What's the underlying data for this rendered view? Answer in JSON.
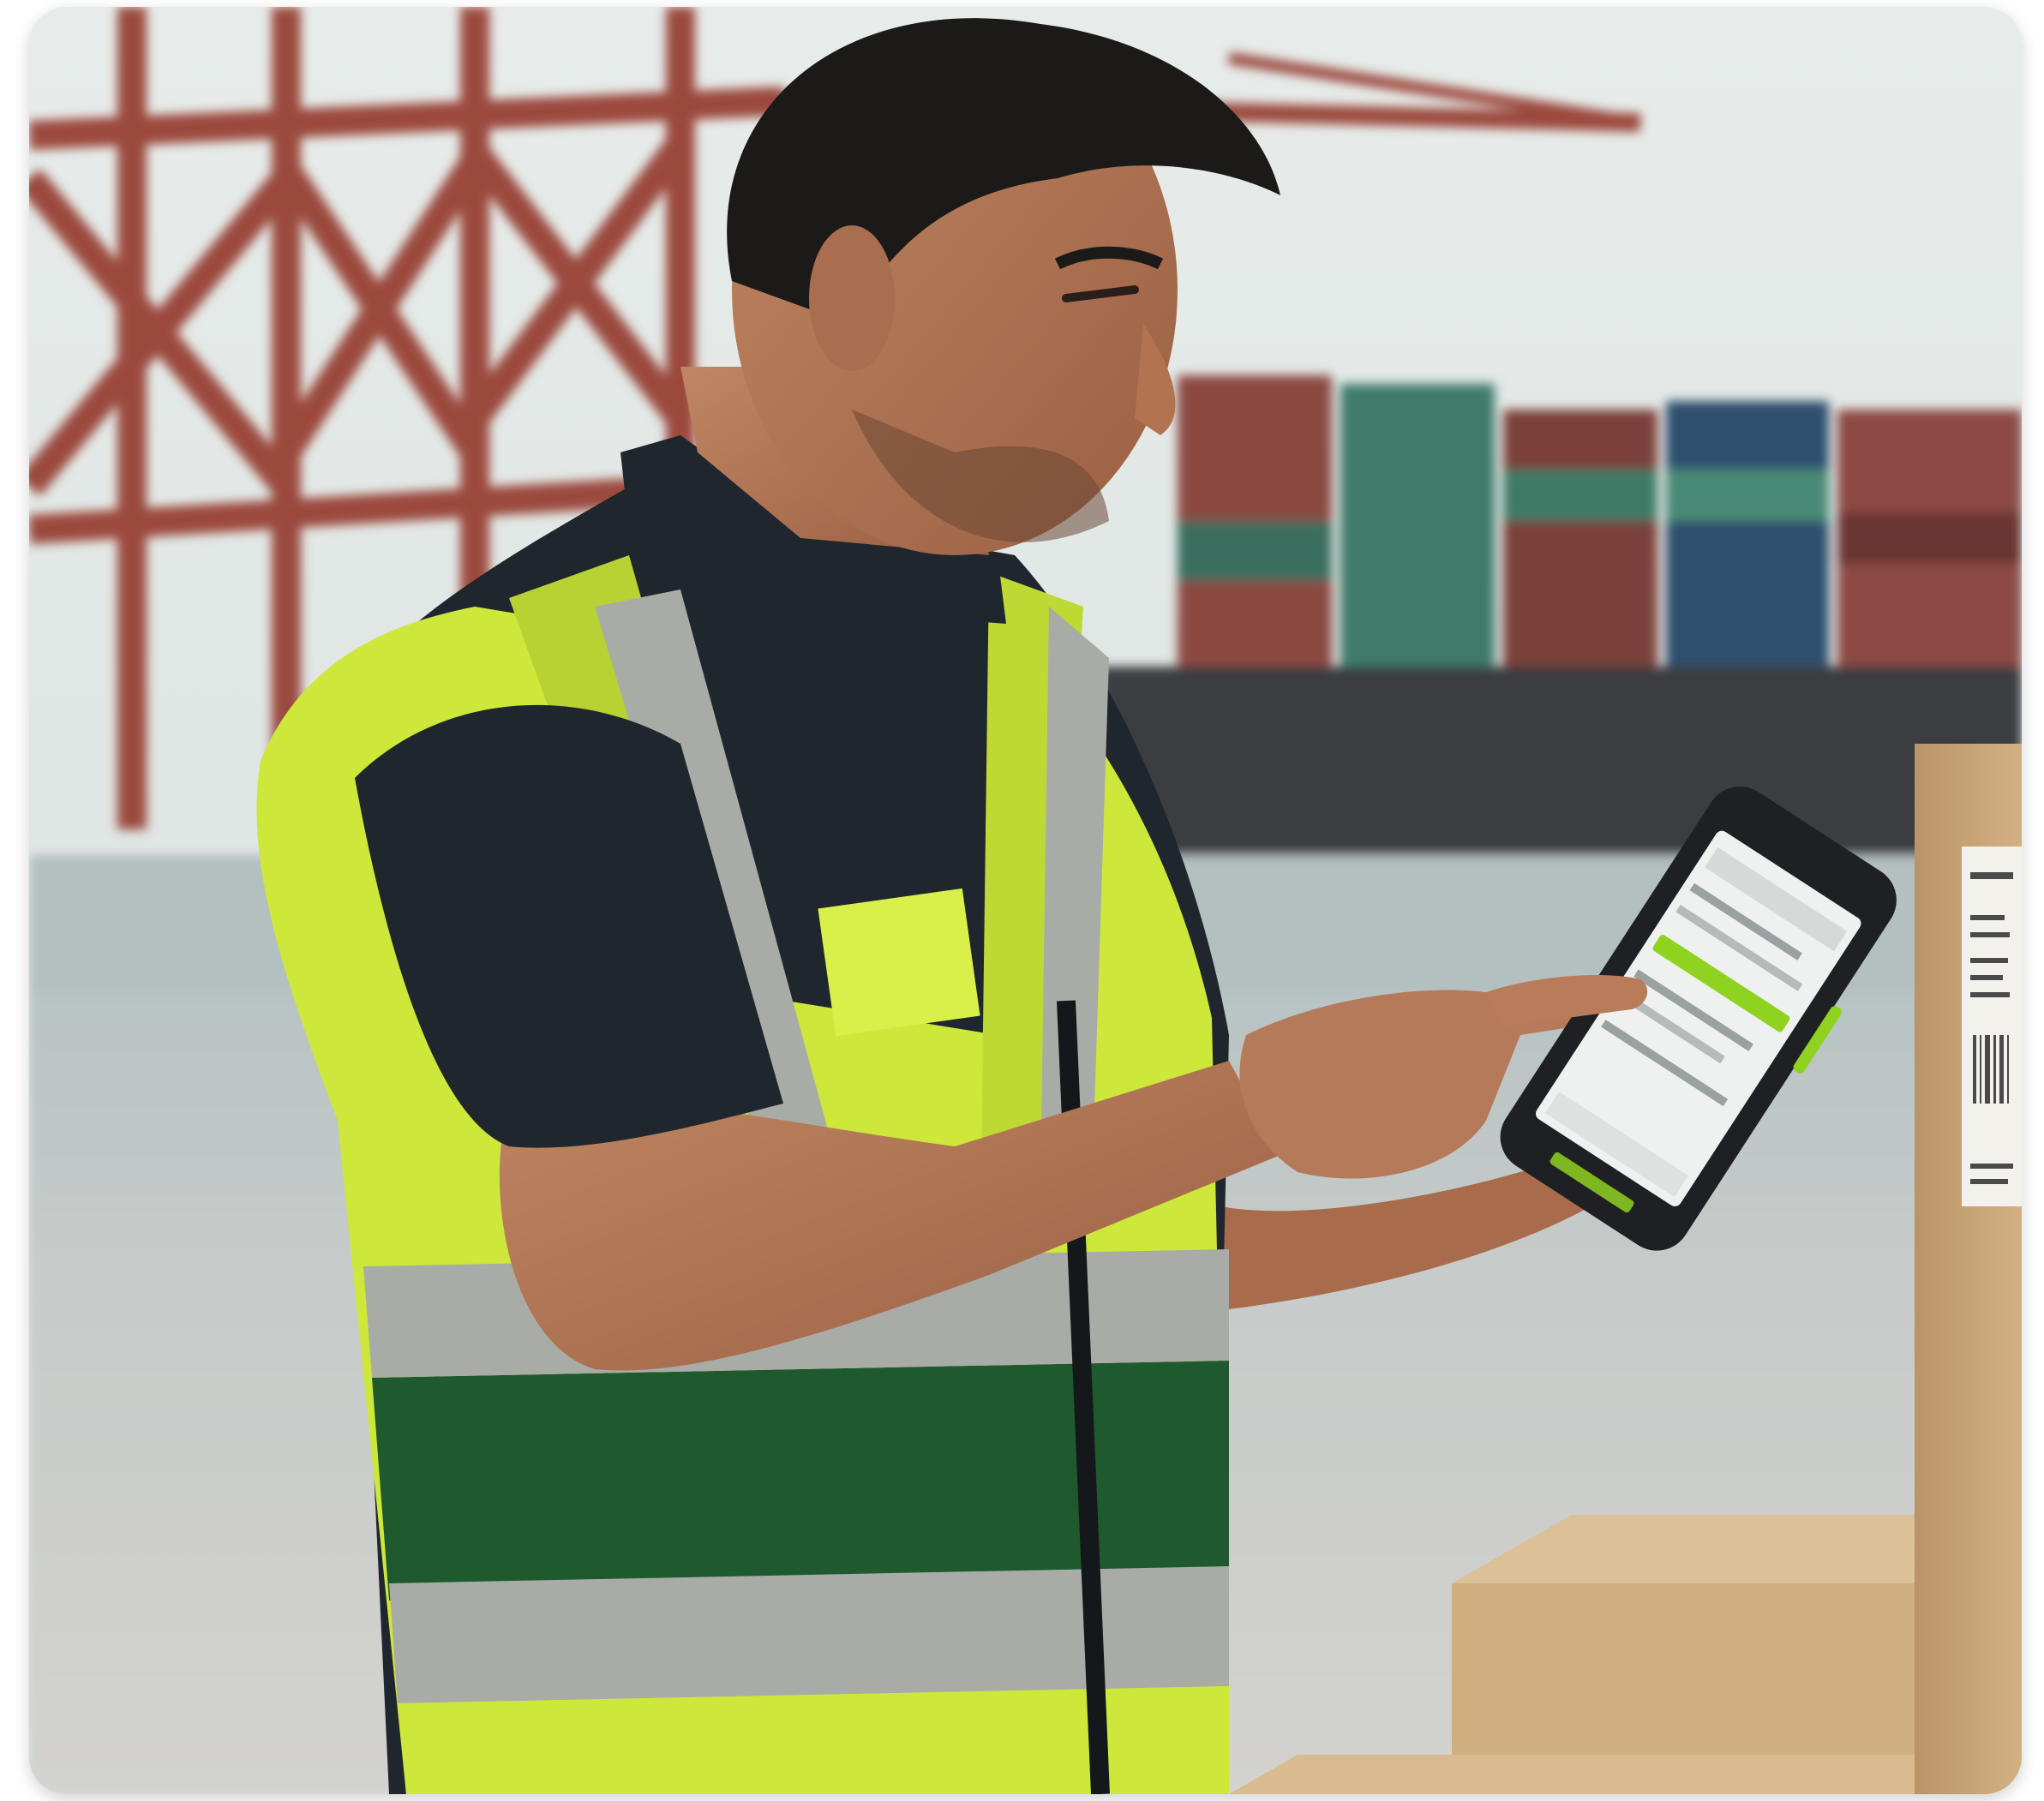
{
  "image": {
    "description_name": "dock-worker-photo",
    "palette": {
      "sky": "#dfe6e4",
      "crane": "#9b4a3c",
      "water": "#b9c4c4",
      "dock": "#c9cac7",
      "vest_yellow": "#cde83a",
      "vest_green": "#1f5a2e",
      "reflective_strip": "#a9aca6",
      "shirt": "#20262e",
      "skin": "#b77b5a",
      "hair": "#1c1a19",
      "box": "#c8a678",
      "device_body": "#1e2023",
      "device_accent": "#8fd21f",
      "screen": "#eef1f0"
    }
  }
}
